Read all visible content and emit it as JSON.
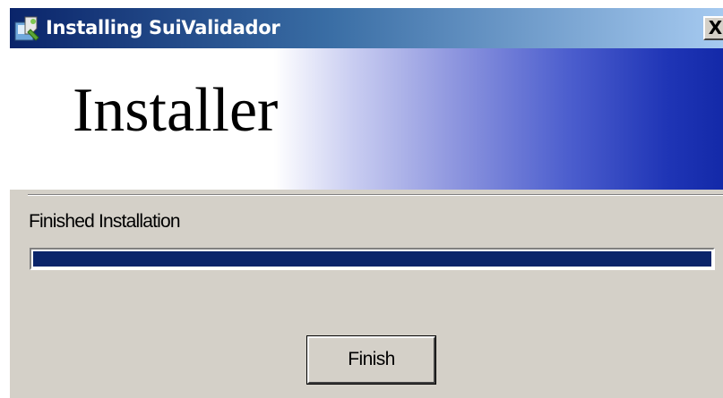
{
  "window": {
    "title": "Installing SuiValidador",
    "close_label": "X",
    "icon": "installer-app-icon",
    "colors": {
      "title_gradient_start": "#0a246a",
      "title_gradient_end": "#a6caf0",
      "face": "#d4d0c8"
    }
  },
  "banner": {
    "title": "Installer",
    "gradient_end_color": "#1329a8"
  },
  "status": {
    "label": "Finished Installation",
    "progress": 1.0,
    "progress_color": "#0a246a"
  },
  "buttons": {
    "finish_label": "Finish"
  }
}
